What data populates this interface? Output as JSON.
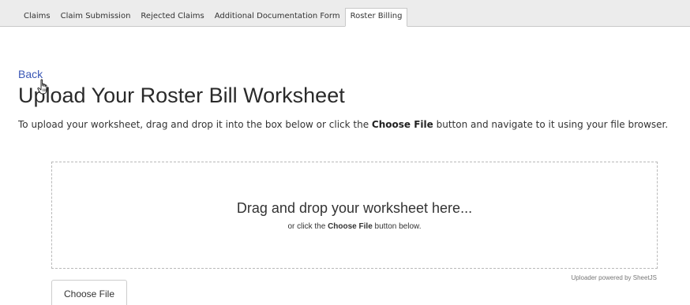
{
  "tabs": [
    {
      "label": "Claims"
    },
    {
      "label": "Claim Submission"
    },
    {
      "label": "Rejected Claims"
    },
    {
      "label": "Additional Documentation Form"
    },
    {
      "label": "Roster Billing",
      "active": true
    }
  ],
  "back_link": "Back",
  "page_title": "Upload Your Roster Bill Worksheet",
  "instructions": {
    "part1": "To upload your worksheet, drag and drop it into the box below or click the ",
    "bold": "Choose File",
    "part2": " button and navigate to it using your file browser."
  },
  "dropzone": {
    "main_text": "Drag and drop your worksheet here...",
    "sub_part1": "or click the ",
    "sub_bold": "Choose File",
    "sub_part2": " button below.",
    "powered_by": "Uploader powered by SheetJS"
  },
  "choose_file_button": "Choose File",
  "colors": {
    "link": "#3a57b5",
    "tabbar_bg": "#ececec",
    "dropzone_border": "#b9b9b9"
  },
  "icons": {
    "cursor": "hand-pointer-icon"
  }
}
